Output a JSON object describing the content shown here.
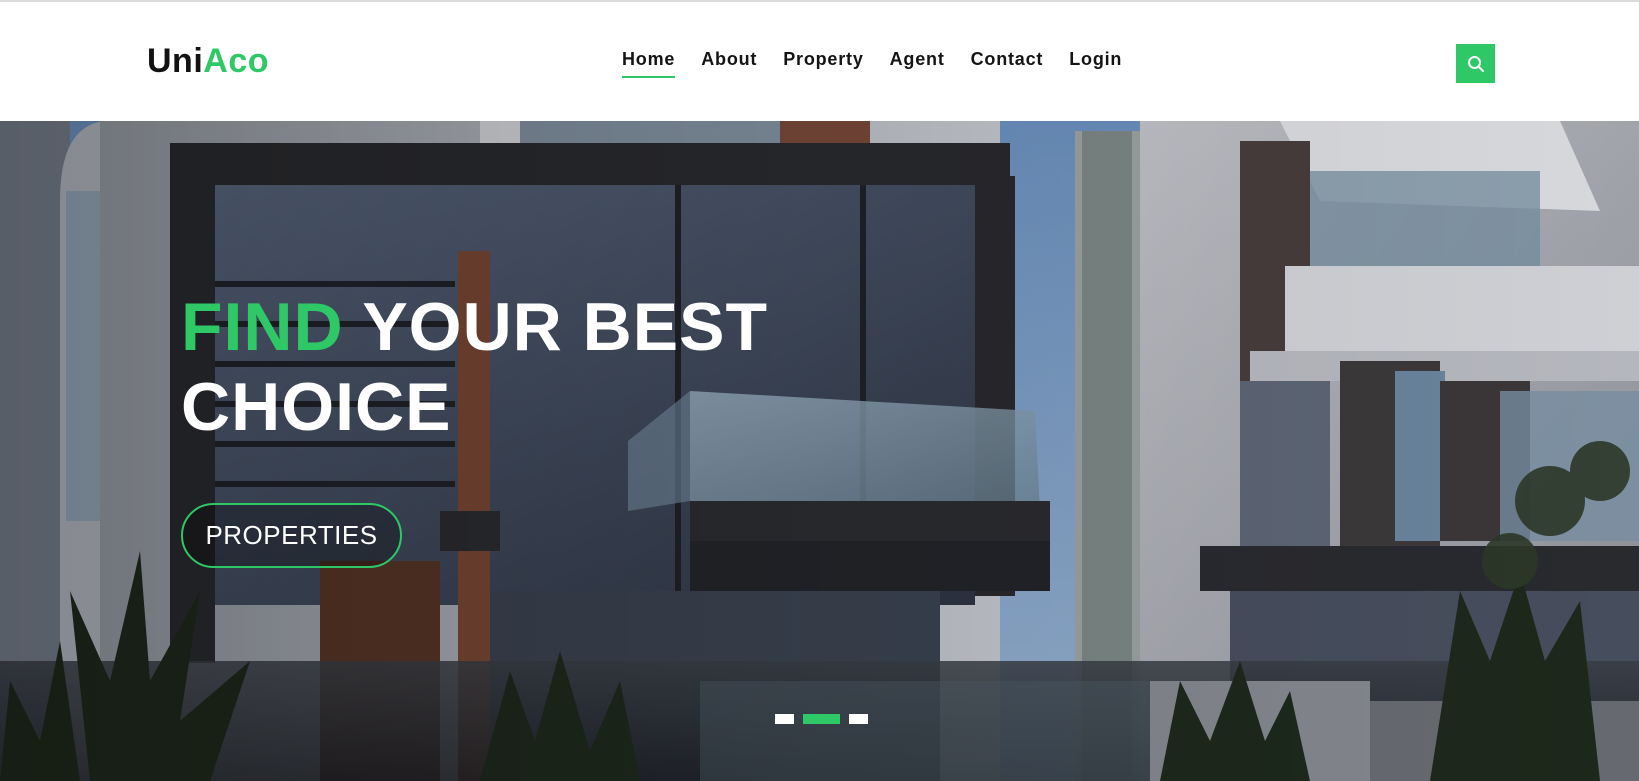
{
  "header": {
    "logo": {
      "part1": "Uni",
      "part2": "Aco"
    },
    "nav": [
      {
        "label": "Home",
        "active": true
      },
      {
        "label": "About",
        "active": false
      },
      {
        "label": "Property",
        "active": false
      },
      {
        "label": "Agent",
        "active": false
      },
      {
        "label": "Contact",
        "active": false
      },
      {
        "label": "Login",
        "active": false
      }
    ],
    "search_icon": "search-icon"
  },
  "hero": {
    "title_accent": "FIND",
    "title_rest": "YOUR BEST CHOICE",
    "button_label": "PROPERTIES",
    "slides_total": 3,
    "active_slide": 2
  },
  "colors": {
    "accent": "#2ec866",
    "text_dark": "#141414",
    "white": "#ffffff"
  }
}
